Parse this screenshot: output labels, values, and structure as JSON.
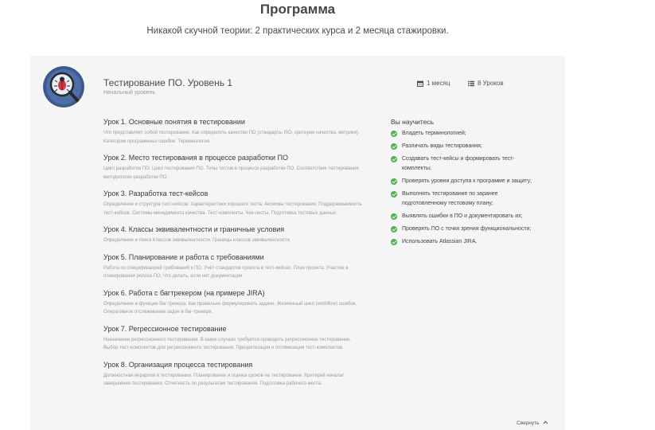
{
  "header": {
    "title": "Программа",
    "subtitle": "Никакой скучной теории: 2 практических курса и 2 месяца стажировки."
  },
  "course": {
    "icon": "bug-magnifier-icon",
    "title": "Тестирование ПО. Уровень 1",
    "level": "Начальный уровень",
    "duration": "1 месяц",
    "lessons_count": "8 Уроков",
    "lessons": [
      {
        "title": "Урок 1. Основные понятия в тестировании",
        "desc": "Что представляет собой тестирование. Как определить качество ПО (стандарты ISO, критерии качества, метрики). Категории программных ошибок. Терминология."
      },
      {
        "title": "Урок 2. Место тестирования в процессе разработки ПО",
        "desc": "Цикл разработки ПО. Цикл тестирования ПО. Типы тестов в процессе разработки ПО. Соответствие тестирования методологии разработки ПО."
      },
      {
        "title": "Урок 3. Разработка тест-кейсов",
        "desc": "Определение и структура тест-кейсов. Характеристики хорошего теста. Аксиомы тестирования. Поддерживаемость тест-кейсов. Системы менеджмента качества. Тест-комплекты. Чек-листы. Подготовка тестовых данных."
      },
      {
        "title": "Урок 4. Классы эквивалентности и граничные условия",
        "desc": "Определение и поиск Классов эквивалентности. Границы классов эквивалентности."
      },
      {
        "title": "Урок 5. Планирование и работа с требованиями",
        "desc": "Работа со спецификацией требований к ПО. Учёт стандартов проекта в тест-кейсах. План проекта. Участие в планировании релиза ПО. Что делать, если нет документации."
      },
      {
        "title": "Урок 6. Работа с багтрекером (на примере JIRA)",
        "desc": "Определение и функции баг-трекера. Как правильно формулировать задачи. Жизненный цикл (workflow) ошибок. Оперативное отслеживание задач в баг-трекере."
      },
      {
        "title": "Урок 7. Регрессионное тестирование",
        "desc": "Назначение регрессионного тестирования. В каких случаях требуется проводить регрессионное тестирование. Выбор тест-комплектов для регрессионного тестирования. Приоретизация и оптимизация тест-комплектов."
      },
      {
        "title": "Урок 8. Организация процесса тестирования",
        "desc": "Должностная иерархия в тестировании. Планирование и оценка сроков на тестирование. Критерий начала/завершения тестирования. Отчетность по результатам тестирования. Подготовка рабочего места."
      }
    ]
  },
  "learn": {
    "heading": "Вы научитесь",
    "items": [
      "Владеть терминологией;",
      "Различать виды тестирования;",
      "Создавать тест-кейсы и формировать тест-комплекты;",
      "Проверять уровни доступа к программе и защиту;",
      "Выполнять тестирование по заранее подготовленному тестовому плану;",
      "Выявлять ошибки в ПО и документировать их;",
      "Проверять ПО с точки зрения функциональности;",
      "Использовать Atlassian JIRA."
    ]
  },
  "collapse_label": "Свернуть",
  "colors": {
    "check": "#4caf50",
    "card_bg": "#f5f5f6",
    "icon_ring": "#3d5a8f"
  }
}
